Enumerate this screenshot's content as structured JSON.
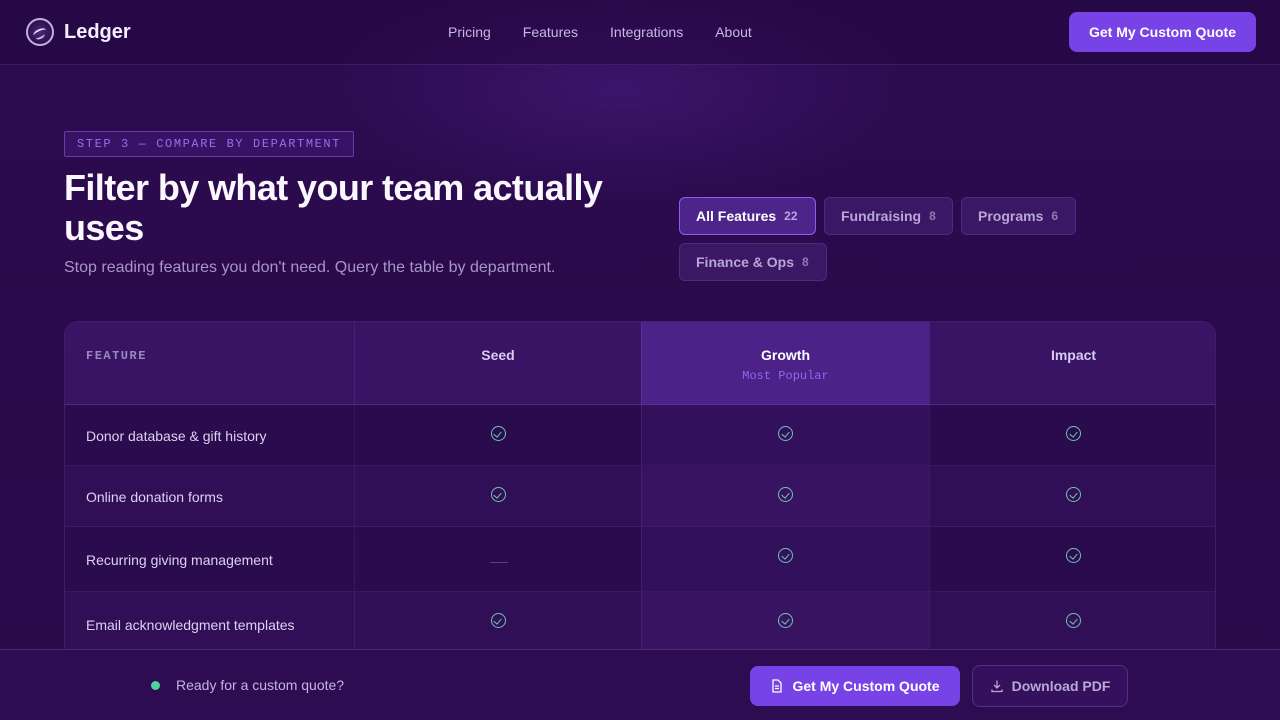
{
  "brand": {
    "name": "Ledger"
  },
  "nav": {
    "links": [
      "Pricing",
      "Features",
      "Integrations",
      "About"
    ],
    "cta": "Get My Custom Quote"
  },
  "hero": {
    "step": "STEP 3 — COMPARE BY DEPARTMENT",
    "title": "Filter by what your team actually uses",
    "subtitle": "Stop reading features you don't need. Query the table by department."
  },
  "filters": [
    {
      "label": "All Features",
      "count": "22",
      "active": true
    },
    {
      "label": "Fundraising",
      "count": "8",
      "active": false
    },
    {
      "label": "Programs",
      "count": "6",
      "active": false
    },
    {
      "label": "Finance & Ops",
      "count": "8",
      "active": false
    }
  ],
  "table": {
    "feature_header": "FEATURE",
    "plans": [
      {
        "name": "Seed",
        "badge": ""
      },
      {
        "name": "Growth",
        "badge": "Most Popular"
      },
      {
        "name": "Impact",
        "badge": ""
      }
    ],
    "rows": [
      {
        "feature": "Donor database & gift history",
        "values": [
          true,
          true,
          true
        ]
      },
      {
        "feature": "Online donation forms",
        "values": [
          true,
          true,
          true
        ]
      },
      {
        "feature": "Recurring giving management",
        "values": [
          false,
          true,
          true
        ]
      },
      {
        "feature": "Email acknowledgment templates",
        "values": [
          true,
          true,
          true
        ]
      }
    ]
  },
  "bottom_bar": {
    "status": "Ready for a custom quote?",
    "primary": "Get My Custom Quote",
    "secondary": "Download PDF"
  },
  "colors": {
    "background": "#2a0a4c",
    "accent": "#7743e6",
    "check": "#6fc3b4",
    "status_dot": "#4fd1a0"
  },
  "icons": {
    "check": "check-circle-icon",
    "dash": "dash-icon",
    "quote": "document-icon",
    "download": "download-icon"
  }
}
